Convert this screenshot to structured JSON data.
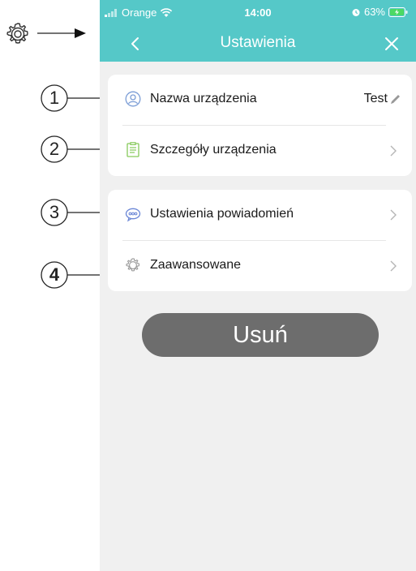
{
  "status_bar": {
    "carrier": "Orange",
    "time": "14:00",
    "battery": "63%"
  },
  "nav": {
    "title": "Ustawienia",
    "back_icon": "chevron-left-icon",
    "close_icon": "close-icon"
  },
  "settings_groups": [
    {
      "rows": [
        {
          "icon": "user-icon",
          "label": "Nazwa urządzenia",
          "value": "Test",
          "action_icon": "pencil-icon"
        },
        {
          "icon": "document-icon",
          "label": "Szczegóły urządzenia",
          "action_icon": "chevron-right-icon"
        }
      ]
    },
    {
      "rows": [
        {
          "icon": "chat-bubble-icon",
          "label": "Ustawienia powiadomień",
          "action_icon": "chevron-right-icon"
        },
        {
          "icon": "gear-icon",
          "label": "Zaawansowane",
          "action_icon": "chevron-right-icon"
        }
      ]
    }
  ],
  "delete_button": {
    "label": "Usuń"
  },
  "annotations": {
    "callouts": [
      "1",
      "2",
      "3",
      "4"
    ]
  },
  "colors": {
    "accent": "#55c8c8",
    "background": "#f0f0f0",
    "delete_button": "#6d6d6d"
  }
}
